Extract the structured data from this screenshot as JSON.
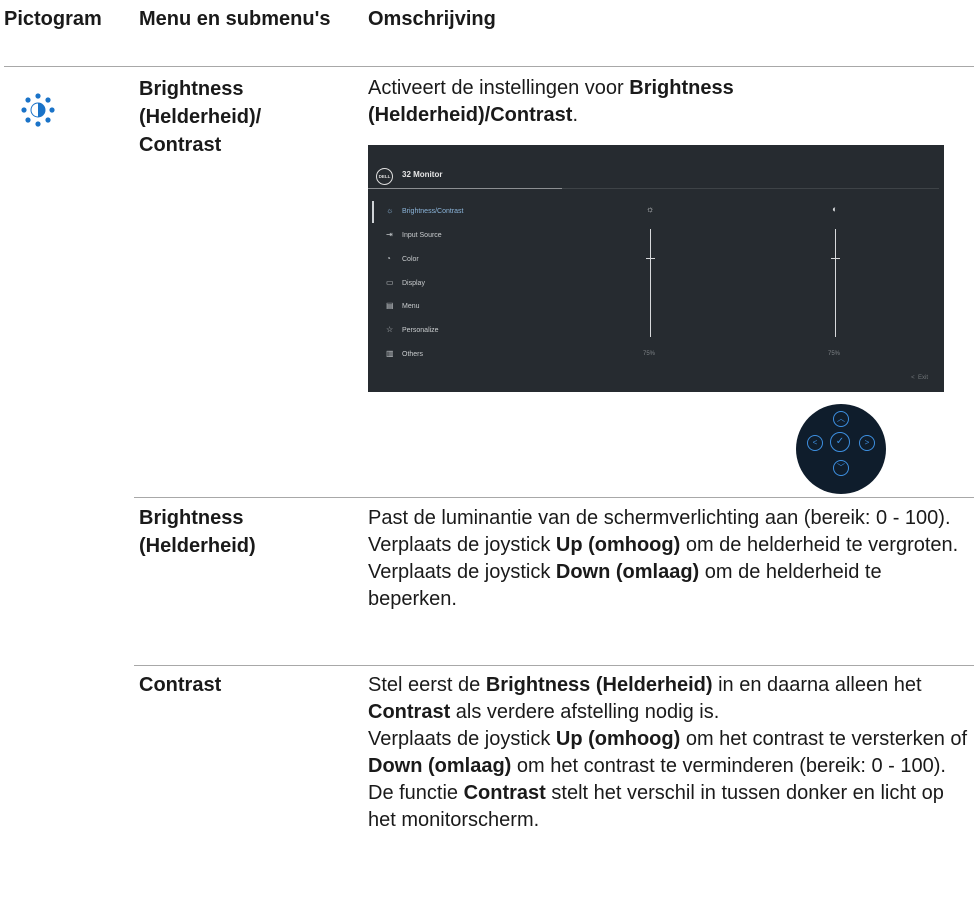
{
  "header": {
    "pictogram": "Pictogram",
    "menu": "Menu en submenu's",
    "description": "Omschrijving"
  },
  "rows": [
    {
      "icon": "brightness-icon",
      "menu": "Brightness (Helderheid)/ Contrast",
      "desc_plain_1": "Activeert de instellingen voor ",
      "desc_bold_1": "Brightness (Helderheid)/Contrast",
      "desc_plain_2": "."
    },
    {
      "menu": "Brightness (Helderheid)",
      "line1": "Past de luminantie van de schermverlichting aan (bereik: 0 - 100).",
      "line2_a": "Verplaats de joystick ",
      "line2_b": "Up (omhoog)",
      "line2_c": " om de helderheid te vergroten.",
      "line3_a": "Verplaats de joystick ",
      "line3_b": "Down (omlaag)",
      "line3_c": " om de helderheid te beperken."
    },
    {
      "menu": "Contrast",
      "p1_a": "Stel eerst de ",
      "p1_b": "Brightness (Helderheid)",
      "p1_c": " in en daarna alleen het ",
      "p1_d": "Contrast",
      "p1_e": " als verdere afstelling nodig is.",
      "p2_a": "Verplaats de joystick ",
      "p2_b": "Up (omhoog)",
      "p2_c": " om het contrast te versterken of ",
      "p2_d": "Down (omlaag)",
      "p2_e": " om het contrast te verminderen (bereik: 0 - 100).",
      "p3_a": "De functie ",
      "p3_b": "Contrast",
      "p3_c": " stelt het verschil in tussen donker en licht op het monitorscherm."
    }
  ],
  "osd": {
    "logo": "DELL",
    "title": "32 Monitor",
    "items": [
      {
        "icon": "brightness-icon",
        "glyph": "☼",
        "label": "Brightness/Contrast",
        "selected": true
      },
      {
        "icon": "input-source-icon",
        "glyph": "⇥",
        "label": "Input Source"
      },
      {
        "icon": "color-icon",
        "glyph": "◔",
        "label": "Color"
      },
      {
        "icon": "display-icon",
        "glyph": "▭",
        "label": "Display"
      },
      {
        "icon": "menu-icon",
        "glyph": "▤",
        "label": "Menu"
      },
      {
        "icon": "star-icon",
        "glyph": "☆",
        "label": "Personalize"
      },
      {
        "icon": "others-icon",
        "glyph": "▥",
        "label": "Others"
      }
    ],
    "brightness_value": "75%",
    "contrast_value": "75%",
    "brightness_level": 0.75,
    "contrast_level": 0.75,
    "exit": "Exit"
  },
  "colors": {
    "icon_blue": "#1a73c8",
    "osd_bg": "#262b30",
    "joystick_bg": "#0f1d2c",
    "joystick_accent": "#3d8fe0"
  }
}
